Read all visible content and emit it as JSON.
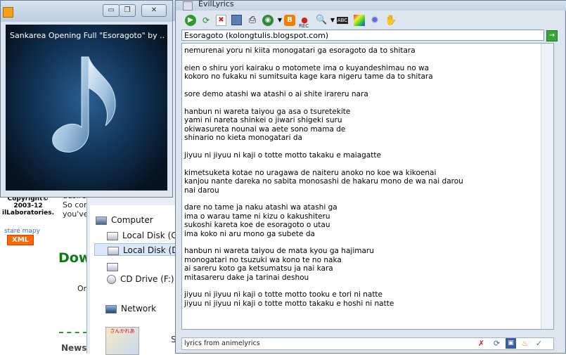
{
  "player": {
    "caption": "Sankarea Opening Full \"Esoragoto\" by ...",
    "buttons": {
      "minimize": "▭",
      "restore": "❐",
      "close": "✕"
    }
  },
  "background_page": {
    "copyright_lines": [
      "Copyright©",
      "2003-12",
      "ilLaboratories."
    ],
    "stare_mapy": "staré mapy",
    "xml_badge": "XML",
    "partial_heading": "Dow",
    "partial_text": "Or",
    "desire_lines": [
      "desire",
      "So com",
      "you've"
    ],
    "news": "News"
  },
  "explorer": {
    "tree": [
      {
        "label": "Computer",
        "icon": "computer-icon"
      },
      {
        "label": "Local Disk (C",
        "icon": "drive-icon"
      },
      {
        "label": "Local Disk (D",
        "icon": "drive-icon"
      },
      {
        "label": "",
        "icon": "drive-icon"
      },
      {
        "label": "CD Drive (F:)",
        "icon": "cd-icon"
      },
      {
        "label": "Network",
        "icon": "network-icon"
      }
    ],
    "thumbnail_text": "さんかれあ",
    "stray_char": "S"
  },
  "evillyrics": {
    "title": "EvilLyrics",
    "address": "Esoragoto  (kolongtulis.blogspot.com)",
    "lyrics": "nemurenai yoru ni kiita monogatari ga esoragoto da to shitara\n\neien o shiru yori kairaku o motomete ima o kuyandeshimau no wa\nkokoro no fukaku ni sumitsuita kage kara nigeru tame da to shitara\n\nsore demo atashi wa atashi o ai shite irareru nara\n\nhanbun ni wareta taiyou ga asa o tsuretekite\nyami ni nareta shinkei o jiwari shigeki suru\nokiwasureta nounai wa aete sono mama de\nshinario no kieta monogatari da\n\njiyuu ni jiyuu ni kaji o totte motto takaku e maiagatte\n\nkimetsuketa kotae no uragawa de naiteru anoko no koe wa kikoenai\nkanjou nante dareka no sabita monosashi de hakaru mono de wa nai darou\nnai darou\n\ndare no tame ja naku atashi wa atashi ga\nima o warau tame ni kizu o kakushiteru\nsukoshi kareta koe de esoragoto o utau\nima koko ni aru mono ga subete da\n\nhanbun ni wareta taiyou de mata kyou ga hajimaru\nmonogatari no tsuzuki wa kono te no naka\nai sareru koto ga ketsumatsu ja nai kara\nmitasareru dake ja tarinai deshou\n\njiyuu ni jiyuu ni kaji o totte motto tooku e tori ni natte\njiyuu ni jiyuu ni kaji o totte motto takaku e hoshi ni natte",
    "status": "lyrics from animelyrics",
    "go_label": "→",
    "toolbar_icons": [
      "play-icon",
      "refresh-icon",
      "delete-icon",
      "save-icon",
      "print-icon",
      "web-icon",
      "blogger-icon",
      "record-icon",
      "search-icon",
      "abc-icon",
      "color-icon",
      "settings-icon",
      "hand-icon"
    ],
    "toolbar_small_labels": {
      "record": "REC",
      "abc": "ABC"
    }
  },
  "colors": {
    "accent_green": "#3aa43a",
    "blogger_orange": "#f57d00",
    "title_bar": "#c2d2e4"
  }
}
